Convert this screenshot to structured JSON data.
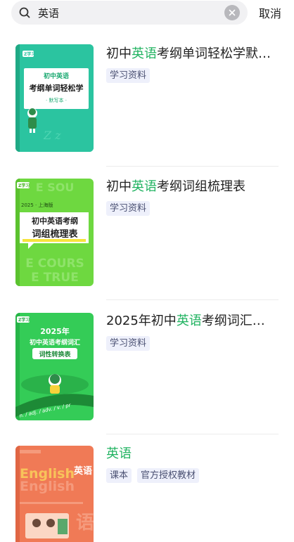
{
  "search": {
    "value": "英语",
    "placeholder": "",
    "cancel_label": "取消"
  },
  "results": [
    {
      "title_before": "初中",
      "title_highlight": "英语",
      "title_after": "考纲单词轻松学默…",
      "tags": [
        "学习资料"
      ],
      "cover": {
        "badge": "Z学习",
        "line1": "初中英语",
        "line2": "考纲单词轻松学",
        "line3": "· 默写本 ·"
      }
    },
    {
      "title_before": "初中",
      "title_highlight": "英语",
      "title_after": "考纲词组梳理表",
      "tags": [
        "学习资料"
      ],
      "cover": {
        "badge": "Z学习",
        "edition": "2025 · 上海版",
        "line1": "初中英语考纲",
        "line2": "词组梳理表",
        "bg_text1": "E SOU",
        "bg_text2": "E COURS",
        "bg_text3": "E TRUE"
      }
    },
    {
      "title_before": "2025年初中",
      "title_highlight": "英语",
      "title_after": "考纲词汇…",
      "tags": [
        "学习资料"
      ],
      "cover": {
        "badge": "Z学习",
        "line1": "2025年",
        "line2": "初中英语考纲词汇",
        "line3": "词性转换表",
        "band_text": "n. / adj. / adv. / v. / pr"
      }
    },
    {
      "title_before": "",
      "title_highlight": "英语",
      "title_after": "",
      "tags": [
        "课本",
        "官方授权教材"
      ],
      "cover": {
        "english": "English",
        "cn": "英语"
      }
    }
  ],
  "colors": {
    "highlight": "#21b361",
    "tag_bg": "#eef0fb",
    "tag_text": "#4a5072",
    "cover1": "#2bc4a0",
    "cover2": "#6ed840",
    "cover3": "#34cc57",
    "cover4": "#f07a56"
  }
}
